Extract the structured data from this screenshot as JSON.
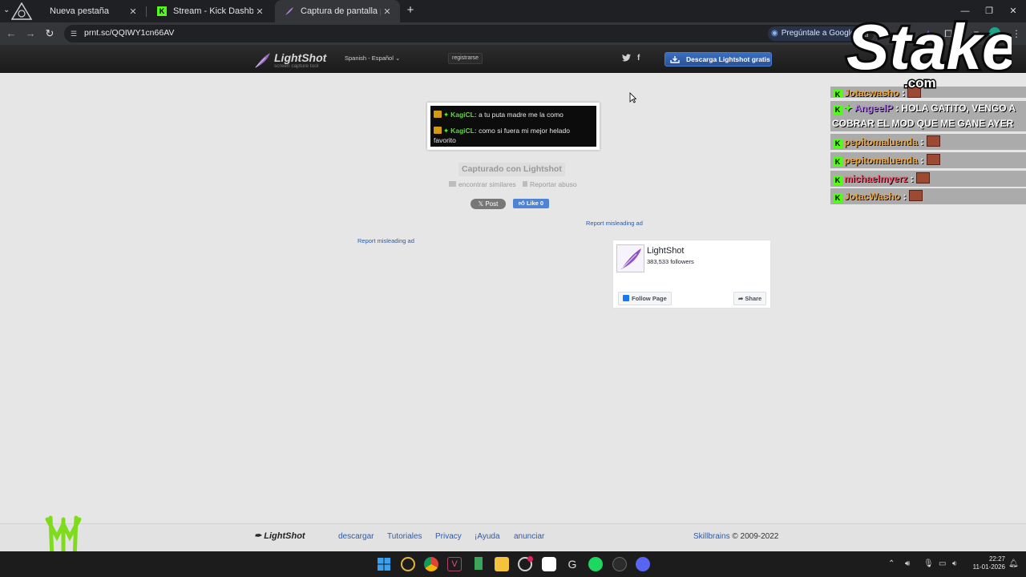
{
  "browser": {
    "tabs": [
      {
        "title": "Nueva pestaña",
        "icon": "new-tab-icon"
      },
      {
        "title": "Stream - Kick Dashboard",
        "icon": "kick-icon"
      },
      {
        "title": "Captura de pantalla por Lightsh",
        "icon": "lightshot-icon"
      }
    ],
    "url": "prnt.sc/QQIWY1cn66AV",
    "gemini_label": "Pregúntale a Google"
  },
  "lightshot": {
    "logo_name": "LightShot",
    "logo_sub": "screen capture tool",
    "language": "Spanish - Español",
    "register": "registrarse",
    "download_button": "Descarga Lightshot gratis",
    "twitter_icon": "t",
    "facebook_icon": "f"
  },
  "overlay": {
    "stake_name": "Stake",
    "stake_domain": ".com"
  },
  "screenshot": {
    "messages": [
      {
        "user": "KagiCL:",
        "text": " a tu puta madre me la como"
      },
      {
        "user": "KagiCL:",
        "text": " como si fuera mi mejor helado favorito"
      }
    ]
  },
  "page": {
    "captured": "Capturado con Lightshot",
    "find_similar": "encontrar similares",
    "report_abuse": "Reportar abuso",
    "x_post": "Post",
    "fb_like": "Like 0",
    "misleading_ad": "Report misleading ad"
  },
  "fb_widget": {
    "name": "LightShot",
    "followers": "383,533 followers",
    "follow": "Follow Page",
    "share": "Share"
  },
  "chat": {
    "rows": [
      {
        "user": "Jotacwasho",
        "sep": " :",
        "color": "#e8a33a",
        "emote": true
      },
      {
        "user": "AngeelP",
        "sep": " : HOLA GATITO, VENGO A COBRAR EL MOD QUE ME GANE AYER",
        "color": "#b57cf0",
        "emote": false
      },
      {
        "user": "pepitomaluenda",
        "sep": " :",
        "color": "#e8a33a",
        "emote": true
      },
      {
        "user": "pepitomaluenda",
        "sep": " :",
        "color": "#e8a33a",
        "emote": true
      },
      {
        "user": "michaelmyerz",
        "sep": " :",
        "color": "#ff4d6a",
        "emote": true
      },
      {
        "user": "JotacWasho",
        "sep": " :",
        "color": "#e8a33a",
        "emote": true
      }
    ]
  },
  "footer": {
    "logo": "LightShot",
    "links": [
      "descargar",
      "Tutoriales",
      "Privacy",
      "¡Ayuda",
      "anunciar"
    ],
    "company": "Skillbrains",
    "copyright": " © 2009-2022"
  },
  "taskbar": {
    "time": "22:27",
    "date": "11-01-2026"
  }
}
